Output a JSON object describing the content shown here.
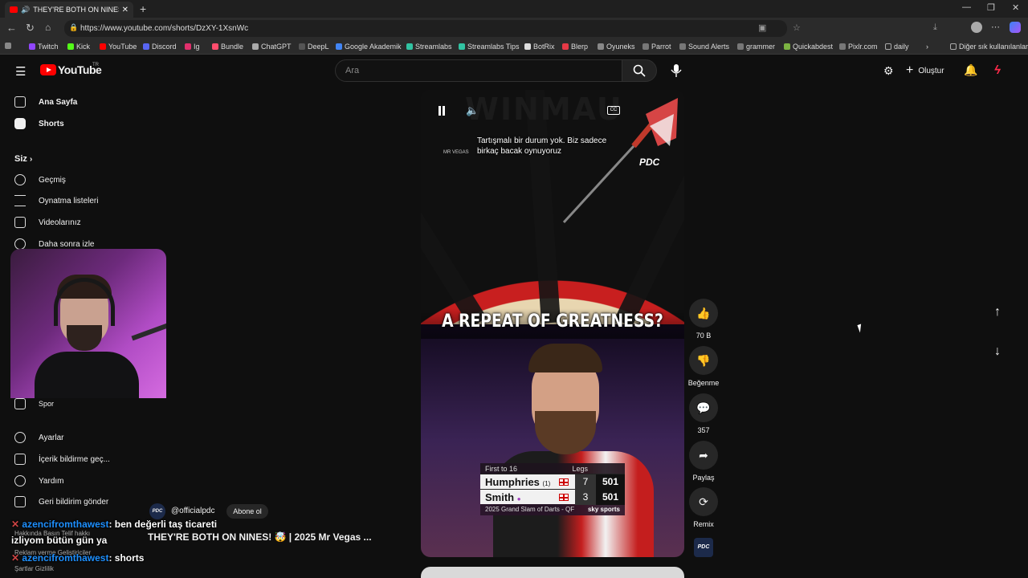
{
  "browser": {
    "tab_title": "THEY'RE BOTH ON NINES! 🤯",
    "url": "https://www.youtube.com/shorts/DzXY-1XsnWc",
    "bookmarks": [
      "Twitch",
      "Kick",
      "YouTube",
      "Discord",
      "Ig",
      "Bundle",
      "ChatGPT",
      "DeepL",
      "Google Akademik",
      "Streamlabs",
      "Streamlabs Tips",
      "BotRix",
      "Blerp",
      "Oyuneks",
      "Parrot",
      "Sound Alerts",
      "grammer",
      "Quickabdest",
      "Pixlr.com",
      "daily"
    ],
    "other_bookmarks": "Diğer sık kullanılanlar"
  },
  "youtube": {
    "logo_text": "YouTube",
    "logo_sup": "TR",
    "search_placeholder": "Ara",
    "create_label": "Oluştur"
  },
  "sidebar": {
    "items": [
      {
        "label": "Ana Sayfa",
        "icon": "home-icon"
      },
      {
        "label": "Shorts",
        "icon": "shorts-icon"
      }
    ],
    "section_title": "Siz",
    "section_items": [
      {
        "label": "Geçmiş",
        "icon": "history-icon"
      },
      {
        "label": "Oynatma listeleri",
        "icon": "playlist-icon"
      },
      {
        "label": "Videolarınız",
        "icon": "videos-icon"
      },
      {
        "label": "Daha sonra izle",
        "icon": "watch-later-icon"
      }
    ],
    "partial_item": "Spor",
    "bottom_items": [
      {
        "label": "Ayarlar",
        "icon": "settings-icon"
      },
      {
        "label": "İçerik bildirme geç...",
        "icon": "flag-icon"
      },
      {
        "label": "Yardım",
        "icon": "help-icon"
      },
      {
        "label": "Geri bildirim gönder",
        "icon": "feedback-icon"
      }
    ],
    "footer_links": [
      "Hakkında Basın Telif hakkı",
      "Reklam verme Geliştiriciler",
      "Şartlar Gizlilik"
    ]
  },
  "video": {
    "board_brand": "WINMAU",
    "subtitle": "Tartışmalı bir durum yok. Biz sadece birkaç bacak oynuyoruz",
    "headline": "A REPEAT OF GREATNESS?",
    "board_sponsor": "MR VEGAS",
    "pdc_logo": "PDC",
    "scoreboard": {
      "header_left": "First to 16",
      "header_right": "Legs",
      "rows": [
        {
          "name": "Humphries",
          "seed": "(1)",
          "legs": "7",
          "points": "501"
        },
        {
          "name": "Smith",
          "seed": "●",
          "legs": "3",
          "points": "501"
        }
      ],
      "footer": "2025 Grand Slam of Darts - QF",
      "broadcaster": "sky sports"
    }
  },
  "actions": {
    "like_count": "70 B",
    "dislike_label": "Beğenme",
    "comment_count": "357",
    "share_label": "Paylaş",
    "remix_label": "Remix"
  },
  "channel": {
    "handle": "@officialpdc",
    "subscribe_label": "Abone ol",
    "video_title": "THEY'RE BOTH ON NINES! 🤯 | 2025 Mr Vegas ..."
  },
  "chat": [
    {
      "user": "azencifromthawest",
      "message": ": ben değerli taş ticareti"
    },
    {
      "user": "",
      "message": "izliyom bütün gün ya"
    },
    {
      "user": "azencifromthawest",
      "message": ": shorts"
    }
  ]
}
